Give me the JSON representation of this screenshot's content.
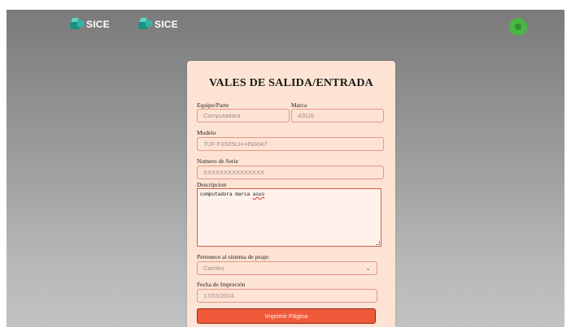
{
  "header": {
    "logo_1_text": "SICE",
    "logo_2_text": "SICE"
  },
  "form": {
    "title": "VALES DE SALIDA/ENTRADA",
    "equipo_label": "Equipo/Parte",
    "equipo_value": "Computadora",
    "marca_label": "Marca",
    "marca_value": "ASUS",
    "modelo_label": "Modelo",
    "modelo_value": "TUF FX505LH-HN0047",
    "serie_label": "Numero de Serie",
    "serie_value": "XXXXXXXXXXXXXXX",
    "descripcion_label": "Descripcion",
    "descripcion_text_1": "computadora marca ",
    "descripcion_text_2": "asus",
    "sistema_label": "Pertenece al sistema de peaje:",
    "sistema_value": "Carriles",
    "fecha_label": "Fecha de Impreción",
    "fecha_value": "17/03/2024",
    "print_button_label": "Imprimir Página"
  },
  "colors": {
    "card_bg": "#fde3d3",
    "input_border": "#e0968a",
    "button_bg": "#f05a3a",
    "avatar_green": "#4ab545"
  },
  "icons": {
    "logo": "sice-logo-icon",
    "avatar": "user-avatar-icon",
    "select": "chevron-down-icon"
  }
}
